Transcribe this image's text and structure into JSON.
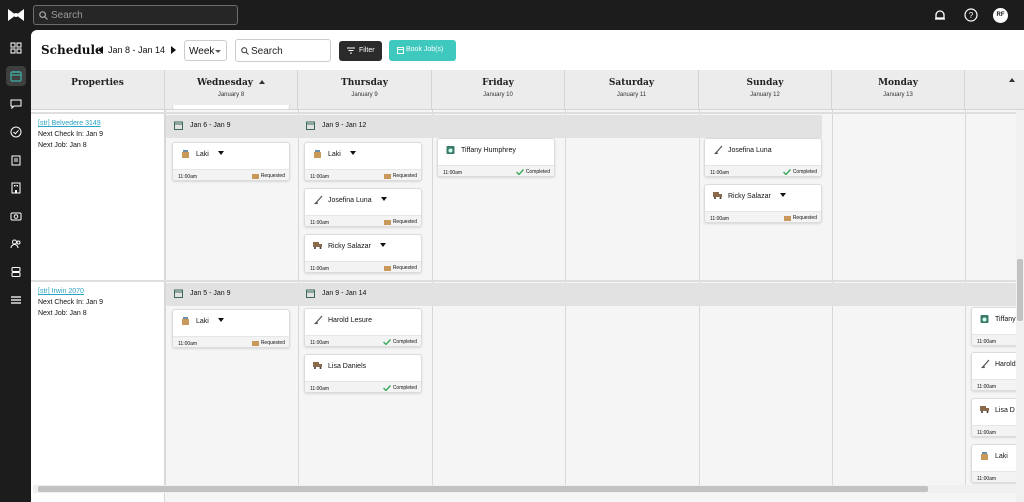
{
  "global_search": {
    "placeholder": "Search"
  },
  "top_icons": [
    "notification-bell-icon",
    "help-icon"
  ],
  "user": {
    "initials": "RF"
  },
  "sidebar": [
    "dashboard-icon",
    "calendar-icon",
    "chat-icon",
    "checkmark-circle-icon",
    "clipboard-icon",
    "property-building-icon",
    "money-icon",
    "team-icon",
    "database-icon",
    "menu-icon"
  ],
  "toolbar": {
    "title": "Schedule",
    "date_range": "Jan 8 - Jan 14",
    "view": "Week",
    "search_placeholder": "Search",
    "filter_label": "Filter",
    "book_label": "Book Job(s)"
  },
  "colors": {
    "accent": "#3ec8be",
    "link": "#2aa3c4",
    "completed": "#3aa85a",
    "requested": "#c8995a"
  },
  "header": {
    "properties_label": "Properties",
    "days": [
      {
        "day": "Wednesday",
        "date": "January 8",
        "sorted": true
      },
      {
        "day": "Thursday",
        "date": "January 9"
      },
      {
        "day": "Friday",
        "date": "January 10"
      },
      {
        "day": "Saturday",
        "date": "January 11"
      },
      {
        "day": "Sunday",
        "date": "January 12"
      },
      {
        "day": "Monday",
        "date": "January 13"
      }
    ]
  },
  "rows": [
    {
      "property_name": "[str] Belvedere 3149",
      "next_check_in": "Next Check In: Jan 9",
      "next_job": "Next Job: Jan 8",
      "stays": [
        {
          "label": "Jan 6 - Jan 9"
        },
        {
          "label": "Jan 9 - Jan 12"
        }
      ],
      "jobs": [
        {
          "name": "Laki",
          "time": "11:00am",
          "status": "Requested",
          "dropdown": true
        },
        {
          "name": "Laki",
          "time": "11:00am",
          "status": "Requested",
          "dropdown": true
        },
        {
          "name": "Josefina Luna",
          "time": "11:00am",
          "status": "Requested",
          "dropdown": true
        },
        {
          "name": "Ricky Salazar",
          "time": "11:00am",
          "status": "Requested",
          "dropdown": true
        },
        {
          "name": "Tiffany Humphrey",
          "time": "11:00am",
          "status": "Completed",
          "dropdown": false
        },
        {
          "name": "Josefina Luna",
          "time": "11:00am",
          "status": "Completed",
          "dropdown": false
        },
        {
          "name": "Ricky Salazar",
          "time": "11:00am",
          "status": "Requested",
          "dropdown": true
        }
      ]
    },
    {
      "property_name": "[str] Irwin 2070",
      "next_check_in": "Next Check In: Jan 9",
      "next_job": "Next Job: Jan 8",
      "stays": [
        {
          "label": "Jan 5 - Jan 9"
        },
        {
          "label": "Jan 9 - Jan 14"
        }
      ],
      "jobs": [
        {
          "name": "Laki",
          "time": "11:00am",
          "status": "Requested",
          "dropdown": true
        },
        {
          "name": "Harold Lesure",
          "time": "11:00am",
          "status": "Completed",
          "dropdown": false
        },
        {
          "name": "Lisa Daniels",
          "time": "11:00am",
          "status": "Completed",
          "dropdown": false
        }
      ],
      "overflow_jobs": [
        {
          "name": "Tiffany",
          "time": "11:00am"
        },
        {
          "name": "Harold",
          "time": "11:00am"
        },
        {
          "name": "Lisa D",
          "time": "11:00am"
        },
        {
          "name": "Laki",
          "time": "11:00am"
        }
      ]
    }
  ]
}
